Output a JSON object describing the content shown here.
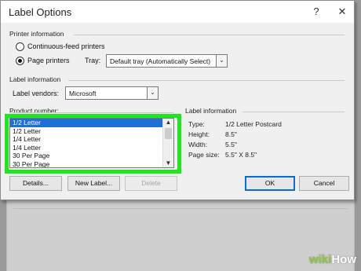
{
  "dialog": {
    "title": "Label Options",
    "help_glyph": "?",
    "close_glyph": "✕"
  },
  "printer_info": {
    "section_label": "Printer information",
    "continuous_label": "Continuous-feed printers",
    "page_label": "Page printers",
    "tray_label": "Tray:",
    "tray_value": "Default tray (Automatically Select)"
  },
  "label_info_section": {
    "section_label": "Label information",
    "vendors_label": "Label vendors:",
    "vendors_value": "Microsoft"
  },
  "product": {
    "label": "Product number:",
    "items": [
      "1/2 Letter",
      "1/2 Letter",
      "1/4 Letter",
      "1/4 Letter",
      "30 Per Page",
      "30 Per Page"
    ],
    "selected_index": 0,
    "scroll_up": "▲",
    "scroll_down": "▼"
  },
  "label_details": {
    "section_label": "Label information",
    "type_label": "Type:",
    "type_value": "1/2 Letter Postcard",
    "height_label": "Height:",
    "height_value": "8.5\"",
    "width_label": "Width:",
    "width_value": "5.5\"",
    "page_size_label": "Page size:",
    "page_size_value": "5.5\" X 8.5\""
  },
  "buttons": {
    "details": "Details...",
    "new_label": "New Label...",
    "delete": "Delete",
    "ok": "OK",
    "cancel": "Cancel"
  },
  "colors": {
    "highlight": "#22e522",
    "selection": "#1f6fd6",
    "default_button_border": "#0a6ad8"
  },
  "watermark": {
    "wiki": "wiki",
    "how": "How"
  }
}
